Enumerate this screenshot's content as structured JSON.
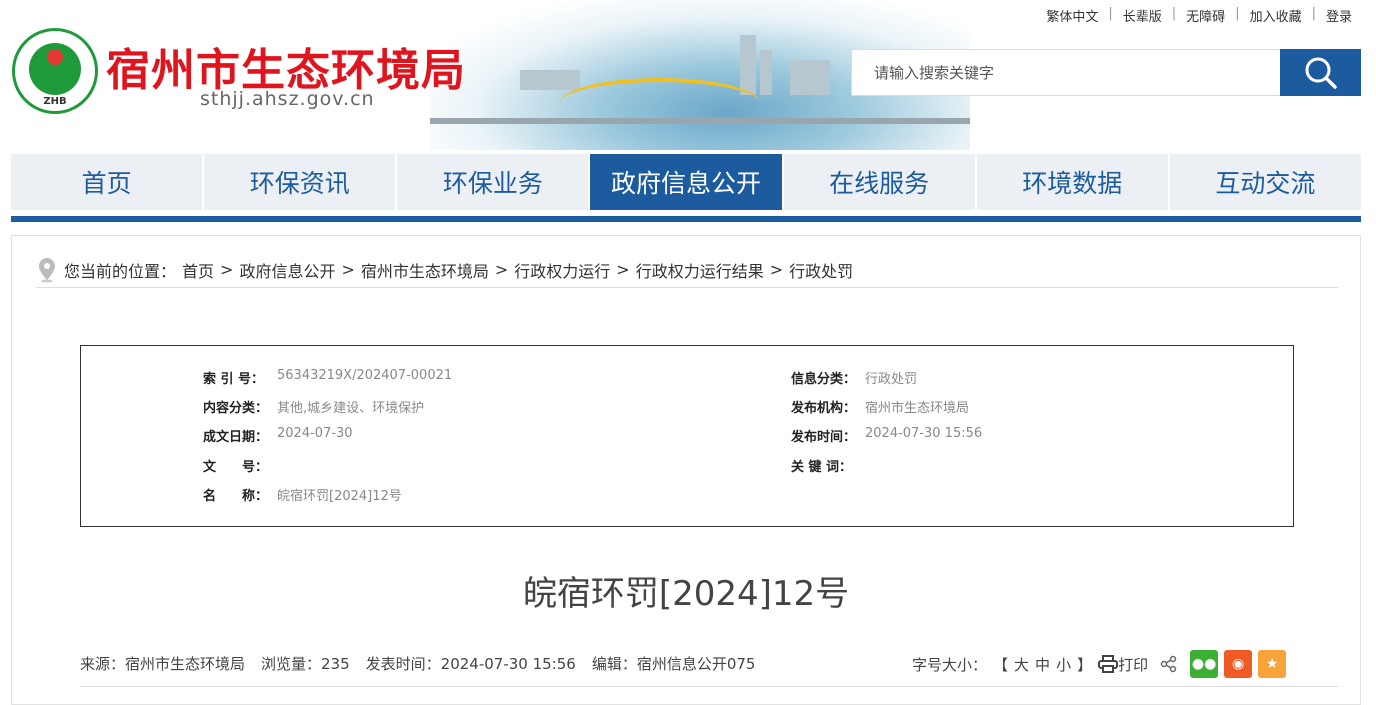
{
  "top_links": [
    "繁体中文",
    "长辈版",
    "无障碍",
    "加入收藏",
    "登录"
  ],
  "header": {
    "title": "宿州市生态环境局",
    "url": "sthjj.ahsz.gov.cn",
    "logo_text": "ZHB"
  },
  "search": {
    "placeholder": "请输入搜索关键字"
  },
  "nav": [
    "首页",
    "环保资讯",
    "环保业务",
    "政府信息公开",
    "在线服务",
    "环境数据",
    "互动交流"
  ],
  "breadcrumb": {
    "prefix": "您当前的位置：",
    "items": [
      "首页",
      "政府信息公开",
      "宿州市生态环境局",
      "行政权力运行",
      "行政权力运行结果",
      "行政处罚"
    ]
  },
  "meta": {
    "left": [
      {
        "k": "索 引 号：",
        "v": "56343219X/202407-00021"
      },
      {
        "k": "内容分类：",
        "v": "其他,城乡建设、环境保护"
      },
      {
        "k": "成文日期：",
        "v": "2024-07-30"
      },
      {
        "k": "文　　号：",
        "v": ""
      },
      {
        "k": "名　　称：",
        "v": "皖宿环罚[2024]12号"
      }
    ],
    "right": [
      {
        "k": "信息分类：",
        "v": "行政处罚"
      },
      {
        "k": "发布机构：",
        "v": "宿州市生态环境局"
      },
      {
        "k": "发布时间：",
        "v": "2024-07-30 15:56"
      },
      {
        "k": "关 键 词：",
        "v": ""
      }
    ]
  },
  "article": {
    "title": "皖宿环罚[2024]12号",
    "source": "来源：宿州市生态环境局",
    "views": "浏览量：235",
    "time": "发表时间：2024-07-30 15:56",
    "editor": "编辑：宿州信息公开075"
  },
  "tools": {
    "font_size": "字号大小：",
    "bracket_l": "【",
    "large": "大",
    "medium": "中",
    "small": "小",
    "bracket_r": "】",
    "print": "打印"
  }
}
